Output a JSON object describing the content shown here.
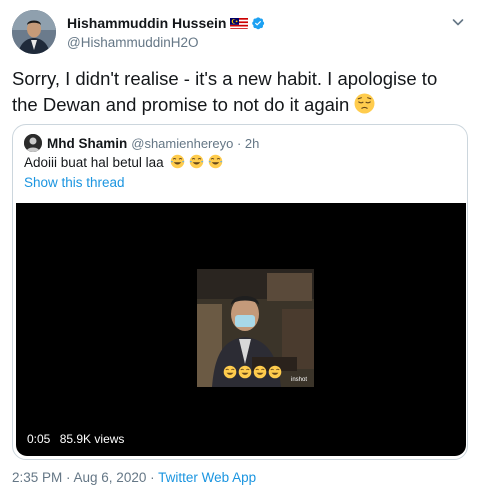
{
  "author": {
    "name": "Hishammuddin Hussein",
    "handle": "@HishammuddinH2O"
  },
  "tweet": {
    "text": "Sorry, I didn't realise - it's a new habit. I apologise to the Dewan and promise to not do it again"
  },
  "quoted": {
    "name": "Mhd Shamin",
    "handle": "@shamienhereyo · 2h",
    "text": "Adoiii buat hal betul laa",
    "link": "Show this thread"
  },
  "video": {
    "duration": "0:05",
    "views": "85.9K views",
    "watermark": "inshot"
  },
  "footer": {
    "datetime": "2:35 PM · Aug 6, 2020 · ",
    "app": "Twitter Web App"
  },
  "colors": {
    "link": "#1b95e0",
    "verified": "#1da1f2",
    "secondary_text": "#657786",
    "border": "#ccd6dd"
  },
  "icons": [
    "malaysia-flag-icon",
    "verified-badge-icon",
    "chevron-down-icon",
    "pensive-face-emoji",
    "tears-of-joy-emoji"
  ]
}
